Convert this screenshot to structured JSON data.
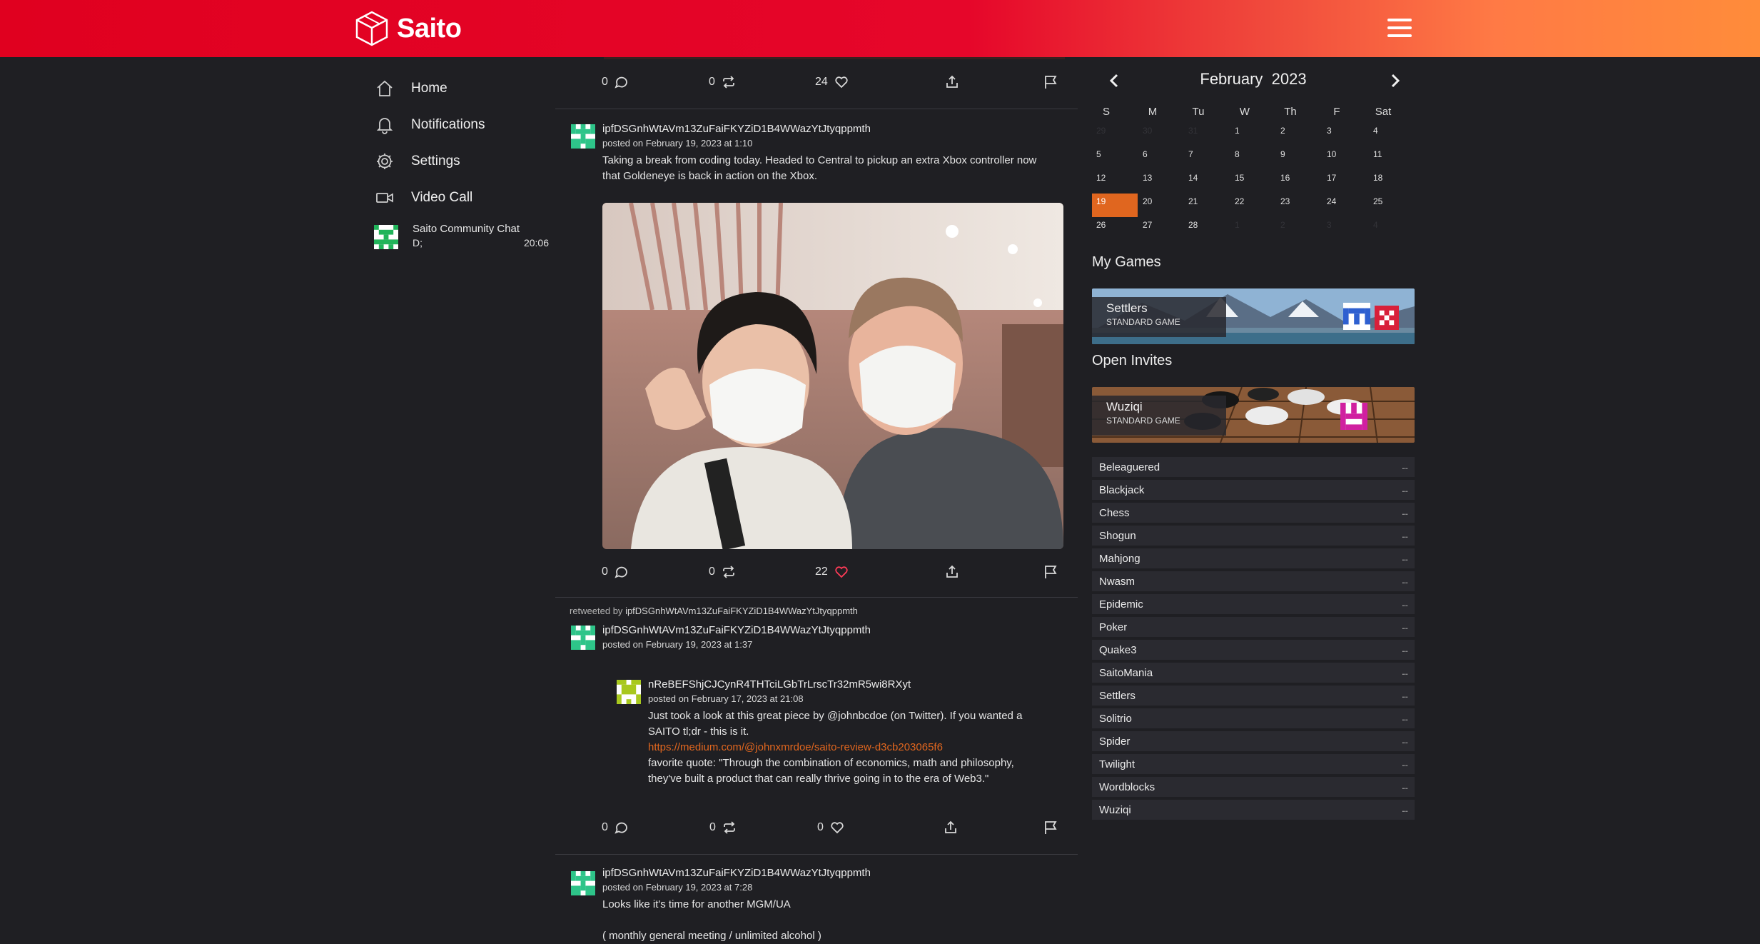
{
  "header": {
    "brand": "Saito",
    "menu_icon": "hamburger-icon",
    "accent": "#e0001f",
    "accent_end": "#ff8c3a"
  },
  "nav": {
    "items": [
      {
        "label": "Home",
        "icon": "home-icon"
      },
      {
        "label": "Notifications",
        "icon": "bell-icon"
      },
      {
        "label": "Settings",
        "icon": "gear-icon"
      },
      {
        "label": "Video Call",
        "icon": "video-camera-icon"
      }
    ],
    "chat": {
      "name": "Saito Community Chat",
      "last_message": "D;",
      "time": "20:06"
    }
  },
  "feed": {
    "top_actions": {
      "comments": "0",
      "retweets": "0",
      "likes": "24"
    },
    "post1": {
      "author": "ipfDSGnhWtAVm13ZuFaiFKYZiD1B4WWazYtJtyqppmth",
      "posted": "posted on February 19, 2023 at 1:10",
      "text_line1": "Taking a break from coding today. Headed to Central to pickup an extra Xbox controller now",
      "text_line2": "that Goldeneye is back in action on the Xbox.",
      "image_alt": "selfie-photo",
      "actions": {
        "comments": "0",
        "retweets": "0",
        "likes": "22"
      }
    },
    "post2": {
      "retweeted_prefix": "retweeted by",
      "retweeted_by": "ipfDSGnhWtAVm13ZuFaiFKYZiD1B4WWazYtJtyqppmth",
      "author": "ipfDSGnhWtAVm13ZuFaiFKYZiD1B4WWazYtJtyqppmth",
      "posted": "posted on February 19, 2023 at 1:37",
      "quoted": {
        "author": "nReBEFShjCJCynR4THTciLGbTrLrscTr32mR5wi8RXyt",
        "posted": "posted on February 17, 2023 at 21:08",
        "line1": "Just took a look at this great piece by @johnbcdoe (on Twitter). If you wanted a",
        "line2": "SAITO tl;dr - this is it.",
        "link": "https://medium.com/@johnxmrdoe/saito-review-d3cb203065f6",
        "line3": "favorite quote: \"Through the combination of economics, math and philosophy,",
        "line4": "they've built a product that can really thrive going in to the era of Web3.\""
      },
      "actions": {
        "comments": "0",
        "retweets": "0",
        "likes": "0"
      }
    },
    "post3": {
      "author": "ipfDSGnhWtAVm13ZuFaiFKYZiD1B4WWazYtJtyqppmth",
      "posted": "posted on February 19, 2023 at 7:28",
      "line1": "Looks like it's time for another MGM/UA",
      "line2": "( monthly general meeting / unlimited alcohol )"
    }
  },
  "calendar": {
    "month": "February",
    "year": "2023",
    "dow": [
      "S",
      "M",
      "Tu",
      "W",
      "Th",
      "F",
      "Sat"
    ],
    "today": "19",
    "prev_month_days": [
      "29",
      "30",
      "31"
    ],
    "next_month_days": [
      "1",
      "2",
      "3",
      "4"
    ],
    "days": [
      "1",
      "2",
      "3",
      "4",
      "5",
      "6",
      "7",
      "8",
      "9",
      "10",
      "11",
      "12",
      "13",
      "14",
      "15",
      "16",
      "17",
      "18",
      "19",
      "20",
      "21",
      "22",
      "23",
      "24",
      "25",
      "26",
      "27",
      "28"
    ],
    "today_color": "#e0661f"
  },
  "games": {
    "my_games_title": "My Games",
    "my_games": [
      {
        "name": "Settlers",
        "type": "STANDARD GAME"
      }
    ],
    "open_invites_title": "Open Invites",
    "open_invites": [
      {
        "name": "Wuziqi",
        "type": "STANDARD GAME"
      }
    ],
    "list": [
      "Beleaguered",
      "Blackjack",
      "Chess",
      "Shogun",
      "Mahjong",
      "Nwasm",
      "Epidemic",
      "Poker",
      "Quake3",
      "SaitoMania",
      "Settlers",
      "Solitrio",
      "Spider",
      "Twilight",
      "Wordblocks",
      "Wuziqi"
    ],
    "more_label": "..."
  }
}
